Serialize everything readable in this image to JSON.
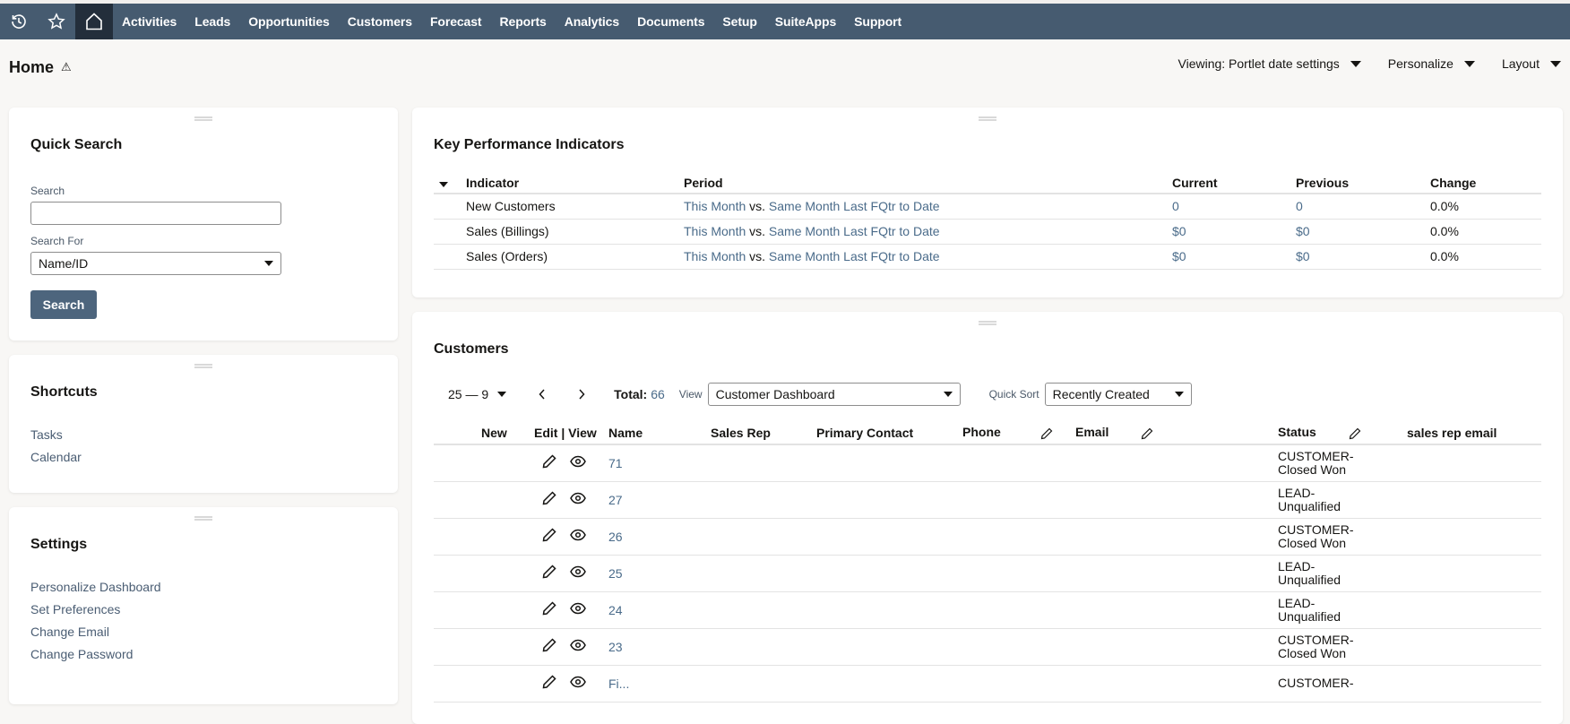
{
  "nav": {
    "icons": [
      "recent-records-icon",
      "favorites-star-icon",
      "home-icon"
    ],
    "items": [
      "Activities",
      "Leads",
      "Opportunities",
      "Customers",
      "Forecast",
      "Reports",
      "Analytics",
      "Documents",
      "Setup",
      "SuiteApps",
      "Support"
    ]
  },
  "page": {
    "title": "Home",
    "warning_icon": "⚠",
    "actions": {
      "viewing": "Viewing: Portlet date settings",
      "personalize": "Personalize",
      "layout": "Layout"
    }
  },
  "quick_search": {
    "title": "Quick Search",
    "search_label": "Search",
    "search_value": "",
    "search_for_label": "Search For",
    "search_for_value": "Name/ID",
    "button": "Search"
  },
  "shortcuts": {
    "title": "Shortcuts",
    "items": [
      "Tasks",
      "Calendar"
    ]
  },
  "settings": {
    "title": "Settings",
    "items": [
      "Personalize Dashboard",
      "Set Preferences",
      "Change Email",
      "Change Password"
    ]
  },
  "kpi": {
    "title": "Key Performance Indicators",
    "columns": [
      "Indicator",
      "Period",
      "Current",
      "Previous",
      "Change"
    ],
    "rows": [
      {
        "indicator": "New Customers",
        "period_a": "This Month",
        "vs": "vs.",
        "period_b": "Same Month Last FQtr to Date",
        "current": "0",
        "previous": "0",
        "change": "0.0%"
      },
      {
        "indicator": "Sales (Billings)",
        "period_a": "This Month",
        "vs": "vs.",
        "period_b": "Same Month Last FQtr to Date",
        "current": "$0",
        "previous": "$0",
        "change": "0.0%"
      },
      {
        "indicator": "Sales (Orders)",
        "period_a": "This Month",
        "vs": "vs.",
        "period_b": "Same Month Last FQtr to Date",
        "current": "$0",
        "previous": "$0",
        "change": "0.0%"
      }
    ]
  },
  "customers": {
    "title": "Customers",
    "page_range": "25 — 9",
    "total_label": "Total:",
    "total_value": "66",
    "view_label": "View",
    "view_value": "Customer Dashboard",
    "quick_sort_label": "Quick Sort",
    "quick_sort_value": "Recently Created",
    "columns": {
      "new": "New",
      "edit_view": "Edit | View",
      "name": "Name",
      "sales_rep": "Sales Rep",
      "primary_contact": "Primary Contact",
      "phone": "Phone",
      "email": "Email",
      "status": "Status",
      "sales_rep_email": "sales rep email"
    },
    "rows": [
      {
        "name": "71",
        "status_a": "CUSTOMER-",
        "status_b": "Closed Won"
      },
      {
        "name": "27",
        "status_a": "LEAD-",
        "status_b": "Unqualified"
      },
      {
        "name": "26",
        "status_a": "CUSTOMER-",
        "status_b": "Closed Won"
      },
      {
        "name": "25",
        "status_a": "LEAD-",
        "status_b": "Unqualified"
      },
      {
        "name": "24",
        "status_a": "LEAD-",
        "status_b": "Unqualified"
      },
      {
        "name": "23",
        "status_a": "CUSTOMER-",
        "status_b": "Closed Won"
      },
      {
        "name": "Fi...",
        "status_a": "CUSTOMER-",
        "status_b": ""
      }
    ]
  },
  "colors": {
    "navbar": "#465b70",
    "nav_active": "#232e3b",
    "button": "#4d657d",
    "link": "#4a6b8a"
  }
}
